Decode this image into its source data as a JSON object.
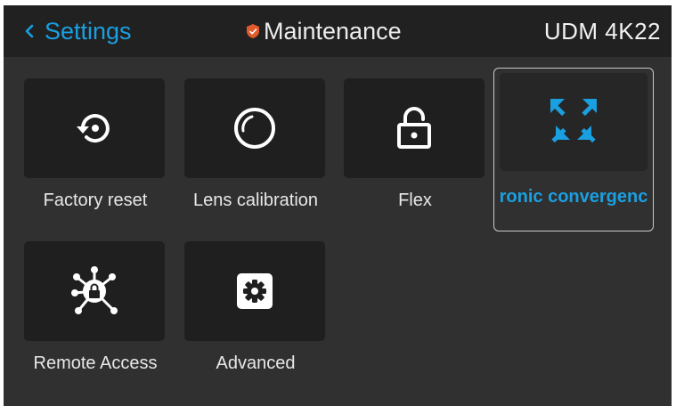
{
  "header": {
    "back_label": "Settings",
    "title": "Maintenance",
    "model": "UDM 4K22",
    "title_icon": "shield-icon",
    "accent_color": "#1a9fe0",
    "shield_color": "#e05a2b"
  },
  "tiles": [
    {
      "label": "Factory reset",
      "icon": "factory-reset-icon"
    },
    {
      "label": "Lens calibration",
      "icon": "lens-calibration-icon"
    },
    {
      "label": "Flex",
      "icon": "unlock-icon"
    },
    {
      "label": "ronic convergenc",
      "icon": "convergence-icon",
      "selected": true
    },
    {
      "label": "Remote Access",
      "icon": "remote-access-icon"
    },
    {
      "label": "Advanced",
      "icon": "gear-icon"
    }
  ]
}
